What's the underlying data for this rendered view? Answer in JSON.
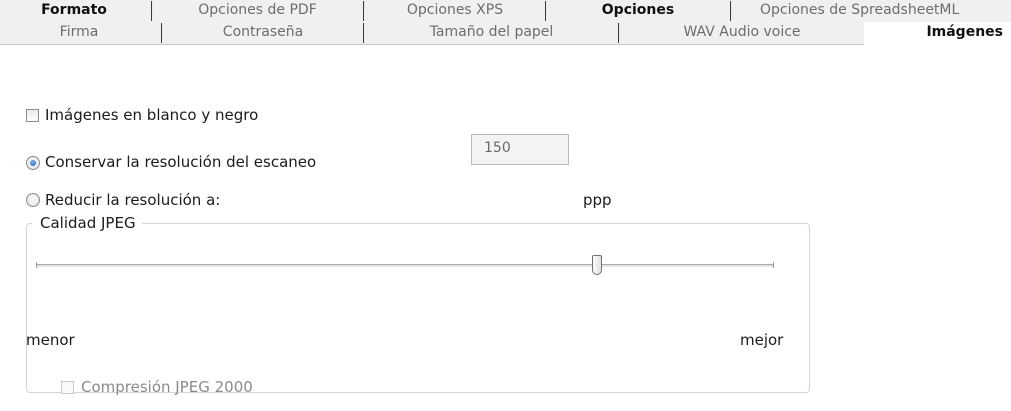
{
  "tabs_row1": [
    {
      "label": "Formato",
      "bold": true
    },
    {
      "label": "Opciones de PDF",
      "bold": false
    },
    {
      "label": "Opciones XPS",
      "bold": false
    },
    {
      "label": "Opciones",
      "bold": true
    },
    {
      "label": "Opciones de SpreadsheetML",
      "bold": false
    }
  ],
  "tabs_row2": [
    {
      "label": "Firma",
      "selected": false
    },
    {
      "label": "Contraseña",
      "selected": false
    },
    {
      "label": "Tamaño del papel",
      "selected": false
    },
    {
      "label": "WAV Audio voice",
      "selected": false
    },
    {
      "label": "Imágenes",
      "selected": true
    }
  ],
  "bw_images": {
    "label": "Imágenes en blanco y negro",
    "checked": false
  },
  "resolution": {
    "keep_label": "Conservar la resolución del escaneo",
    "reduce_label": "Reducir la resolución a:",
    "selected": "keep",
    "value": "150",
    "unit": "ppp"
  },
  "jpeg_quality": {
    "title": "Calidad JPEG",
    "min_label": "menor",
    "max_label": "mejor",
    "level": 0.76
  },
  "jpeg2000": {
    "label": "Compresión JPEG 2000",
    "checked": false,
    "enabled": false
  },
  "colors": {
    "accent": "#1d5fb8",
    "tab_bg": "#f0f0f0"
  }
}
